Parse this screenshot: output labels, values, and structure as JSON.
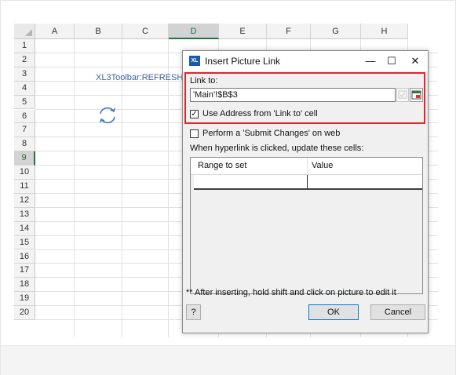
{
  "spreadsheet": {
    "columns": [
      "A",
      "B",
      "C",
      "D",
      "E",
      "F",
      "G",
      "H"
    ],
    "selected_column": "D",
    "rows": [
      "1",
      "2",
      "3",
      "4",
      "5",
      "6",
      "7",
      "8",
      "9",
      "10",
      "11",
      "12",
      "13",
      "14",
      "15",
      "16",
      "17",
      "18",
      "19",
      "20"
    ],
    "selected_row": "9",
    "cell_b3": "XL3Toolbar:REFRESH",
    "refresh_icon": "refresh-arrows-icon"
  },
  "dialog": {
    "app_icon_text": "XL",
    "title": "Insert Picture Link",
    "minimize_glyph": "—",
    "maximize_glyph": "☐",
    "close_glyph": "✕",
    "link_to_label": "Link to:",
    "link_to_value": "'Main'!$B$3",
    "use_address_label": "Use Address from 'Link to' cell",
    "use_address_checked": true,
    "submit_changes_label": "Perform a 'Submit Changes' on web",
    "submit_changes_checked": false,
    "update_cells_label": "When hyperlink is clicked, update these cells:",
    "table_headers": [
      "Range to set",
      "Value"
    ],
    "footnote": "** After inserting, hold shift and click on picture to edit it",
    "help_label": "?",
    "ok_label": "OK",
    "cancel_label": "Cancel",
    "highlight_color": "#e3262e"
  }
}
